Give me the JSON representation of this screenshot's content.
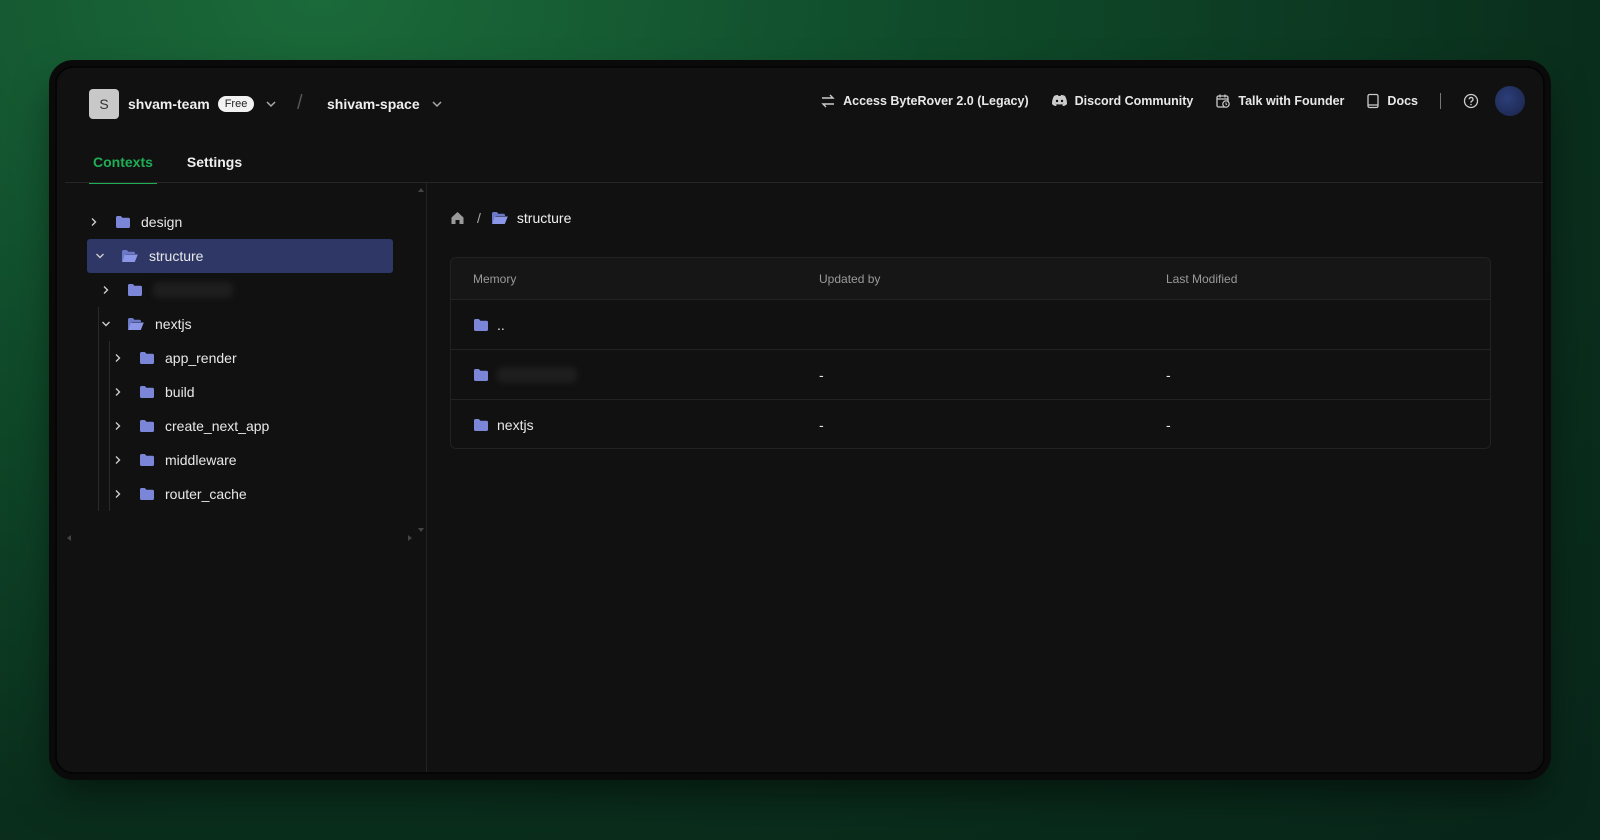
{
  "header": {
    "team_initial": "S",
    "team_name": "shvam-team",
    "plan_badge": "Free",
    "space_name": "shivam-space",
    "links": {
      "legacy": "Access ByteRover 2.0 (Legacy)",
      "discord": "Discord Community",
      "founder": "Talk with Founder",
      "docs": "Docs"
    }
  },
  "tabs": {
    "contexts": "Contexts",
    "settings": "Settings"
  },
  "tree": {
    "design": "design",
    "structure": "structure",
    "nextjs": "nextjs",
    "app_render": "app_render",
    "build": "build",
    "create_next_app": "create_next_app",
    "middleware": "middleware",
    "router_cache": "router_cache"
  },
  "breadcrumb": {
    "current": "structure",
    "separator": "/"
  },
  "table": {
    "headers": {
      "memory": "Memory",
      "updated_by": "Updated by",
      "last_modified": "Last Modified"
    },
    "rows": {
      "parent": {
        "name": "..",
        "updated_by": "",
        "last_modified": ""
      },
      "hidden": {
        "updated_by": "-",
        "last_modified": "-"
      },
      "nextjs": {
        "name": "nextjs",
        "updated_by": "-",
        "last_modified": "-"
      }
    }
  },
  "colors": {
    "accent_green": "#1fae55",
    "selected_bg": "#2e3766",
    "folder": "#7b86d8"
  }
}
